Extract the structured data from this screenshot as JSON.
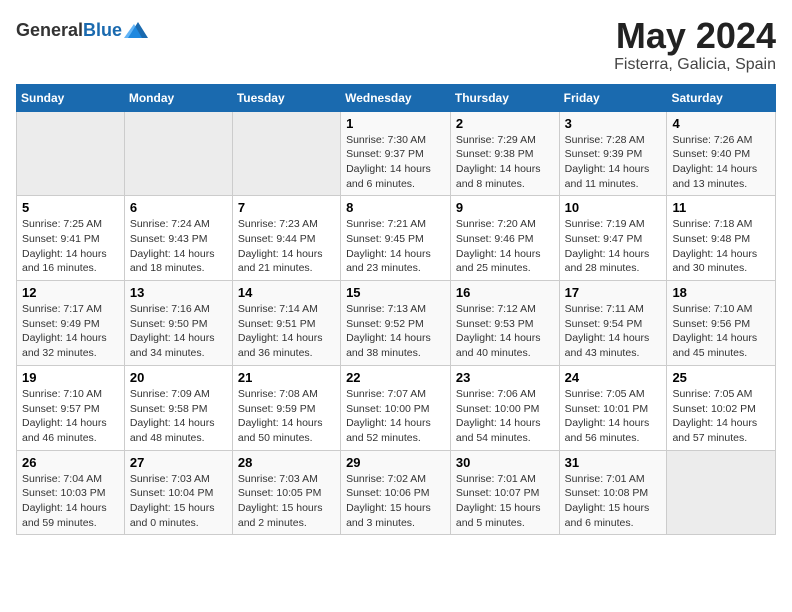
{
  "header": {
    "logo_general": "General",
    "logo_blue": "Blue",
    "title": "May 2024",
    "subtitle": "Fisterra, Galicia, Spain"
  },
  "weekdays": [
    "Sunday",
    "Monday",
    "Tuesday",
    "Wednesday",
    "Thursday",
    "Friday",
    "Saturday"
  ],
  "weeks": [
    [
      {
        "day": "",
        "info": ""
      },
      {
        "day": "",
        "info": ""
      },
      {
        "day": "",
        "info": ""
      },
      {
        "day": "1",
        "info": "Sunrise: 7:30 AM\nSunset: 9:37 PM\nDaylight: 14 hours\nand 6 minutes."
      },
      {
        "day": "2",
        "info": "Sunrise: 7:29 AM\nSunset: 9:38 PM\nDaylight: 14 hours\nand 8 minutes."
      },
      {
        "day": "3",
        "info": "Sunrise: 7:28 AM\nSunset: 9:39 PM\nDaylight: 14 hours\nand 11 minutes."
      },
      {
        "day": "4",
        "info": "Sunrise: 7:26 AM\nSunset: 9:40 PM\nDaylight: 14 hours\nand 13 minutes."
      }
    ],
    [
      {
        "day": "5",
        "info": "Sunrise: 7:25 AM\nSunset: 9:41 PM\nDaylight: 14 hours\nand 16 minutes."
      },
      {
        "day": "6",
        "info": "Sunrise: 7:24 AM\nSunset: 9:43 PM\nDaylight: 14 hours\nand 18 minutes."
      },
      {
        "day": "7",
        "info": "Sunrise: 7:23 AM\nSunset: 9:44 PM\nDaylight: 14 hours\nand 21 minutes."
      },
      {
        "day": "8",
        "info": "Sunrise: 7:21 AM\nSunset: 9:45 PM\nDaylight: 14 hours\nand 23 minutes."
      },
      {
        "day": "9",
        "info": "Sunrise: 7:20 AM\nSunset: 9:46 PM\nDaylight: 14 hours\nand 25 minutes."
      },
      {
        "day": "10",
        "info": "Sunrise: 7:19 AM\nSunset: 9:47 PM\nDaylight: 14 hours\nand 28 minutes."
      },
      {
        "day": "11",
        "info": "Sunrise: 7:18 AM\nSunset: 9:48 PM\nDaylight: 14 hours\nand 30 minutes."
      }
    ],
    [
      {
        "day": "12",
        "info": "Sunrise: 7:17 AM\nSunset: 9:49 PM\nDaylight: 14 hours\nand 32 minutes."
      },
      {
        "day": "13",
        "info": "Sunrise: 7:16 AM\nSunset: 9:50 PM\nDaylight: 14 hours\nand 34 minutes."
      },
      {
        "day": "14",
        "info": "Sunrise: 7:14 AM\nSunset: 9:51 PM\nDaylight: 14 hours\nand 36 minutes."
      },
      {
        "day": "15",
        "info": "Sunrise: 7:13 AM\nSunset: 9:52 PM\nDaylight: 14 hours\nand 38 minutes."
      },
      {
        "day": "16",
        "info": "Sunrise: 7:12 AM\nSunset: 9:53 PM\nDaylight: 14 hours\nand 40 minutes."
      },
      {
        "day": "17",
        "info": "Sunrise: 7:11 AM\nSunset: 9:54 PM\nDaylight: 14 hours\nand 43 minutes."
      },
      {
        "day": "18",
        "info": "Sunrise: 7:10 AM\nSunset: 9:56 PM\nDaylight: 14 hours\nand 45 minutes."
      }
    ],
    [
      {
        "day": "19",
        "info": "Sunrise: 7:10 AM\nSunset: 9:57 PM\nDaylight: 14 hours\nand 46 minutes."
      },
      {
        "day": "20",
        "info": "Sunrise: 7:09 AM\nSunset: 9:58 PM\nDaylight: 14 hours\nand 48 minutes."
      },
      {
        "day": "21",
        "info": "Sunrise: 7:08 AM\nSunset: 9:59 PM\nDaylight: 14 hours\nand 50 minutes."
      },
      {
        "day": "22",
        "info": "Sunrise: 7:07 AM\nSunset: 10:00 PM\nDaylight: 14 hours\nand 52 minutes."
      },
      {
        "day": "23",
        "info": "Sunrise: 7:06 AM\nSunset: 10:00 PM\nDaylight: 14 hours\nand 54 minutes."
      },
      {
        "day": "24",
        "info": "Sunrise: 7:05 AM\nSunset: 10:01 PM\nDaylight: 14 hours\nand 56 minutes."
      },
      {
        "day": "25",
        "info": "Sunrise: 7:05 AM\nSunset: 10:02 PM\nDaylight: 14 hours\nand 57 minutes."
      }
    ],
    [
      {
        "day": "26",
        "info": "Sunrise: 7:04 AM\nSunset: 10:03 PM\nDaylight: 14 hours\nand 59 minutes."
      },
      {
        "day": "27",
        "info": "Sunrise: 7:03 AM\nSunset: 10:04 PM\nDaylight: 15 hours\nand 0 minutes."
      },
      {
        "day": "28",
        "info": "Sunrise: 7:03 AM\nSunset: 10:05 PM\nDaylight: 15 hours\nand 2 minutes."
      },
      {
        "day": "29",
        "info": "Sunrise: 7:02 AM\nSunset: 10:06 PM\nDaylight: 15 hours\nand 3 minutes."
      },
      {
        "day": "30",
        "info": "Sunrise: 7:01 AM\nSunset: 10:07 PM\nDaylight: 15 hours\nand 5 minutes."
      },
      {
        "day": "31",
        "info": "Sunrise: 7:01 AM\nSunset: 10:08 PM\nDaylight: 15 hours\nand 6 minutes."
      },
      {
        "day": "",
        "info": ""
      }
    ]
  ]
}
